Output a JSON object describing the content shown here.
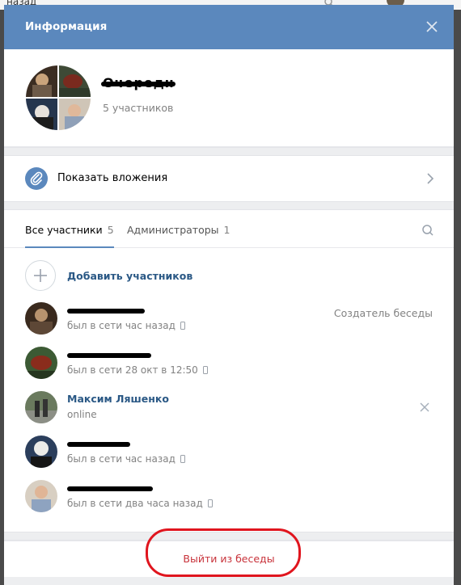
{
  "background": {
    "text": "назад"
  },
  "modal": {
    "title": "Информация"
  },
  "chat": {
    "name": "Очередн",
    "members_count": "5 участников"
  },
  "attachments": {
    "label": "Показать вложения"
  },
  "tabs": [
    {
      "label": "Все участники",
      "count": "5"
    },
    {
      "label": "Администраторы",
      "count": "1"
    }
  ],
  "add_members_label": "Добавить участников",
  "members": [
    {
      "name": "",
      "status": "был в сети час назад",
      "role": "Создатель беседы",
      "mobile": true
    },
    {
      "name": "",
      "status": "был в сети 28 окт в 12:50",
      "role": "",
      "mobile": true
    },
    {
      "name": "Максим Ляшенко",
      "status": "online",
      "role": "",
      "mobile": false
    },
    {
      "name": "",
      "status": "был в сети час назад",
      "role": "",
      "mobile": true
    },
    {
      "name": "",
      "status": "был в сети два часа назад",
      "role": "",
      "mobile": true
    }
  ],
  "leave_label": "Выйти из беседы",
  "colors": {
    "header": "#5b88bd",
    "link": "#2a5885",
    "danger": "#c8323a",
    "annotation": "#e0151e"
  }
}
